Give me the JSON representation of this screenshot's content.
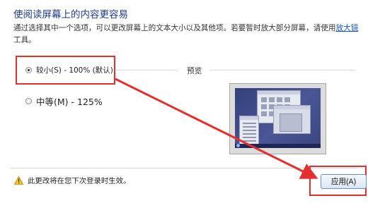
{
  "header": {
    "title": "使阅读屏幕上的内容更容易",
    "description": "通过选择其中一个选项，可以更改屏幕上的文本大小以及其他项。若要暂时放大部分屏幕，请使用",
    "magnifier_link": "放大镜",
    "description_end": "工具。"
  },
  "options": [
    {
      "label": "较小(S) - 100% (默认)",
      "selected": true
    },
    {
      "label": "中等(M) - 125%",
      "selected": false
    }
  ],
  "preview": {
    "label": "预览"
  },
  "footer": {
    "warning_text": "此更改将在您下次登录时生效。",
    "apply_label": "应用(A)"
  },
  "colors": {
    "annotation": "#e32f2f",
    "title": "#1e3a8a",
    "link": "#1a55c4"
  },
  "icons": {
    "warning": "warning-triangle-icon",
    "preview": "monitor-preview-icon"
  }
}
